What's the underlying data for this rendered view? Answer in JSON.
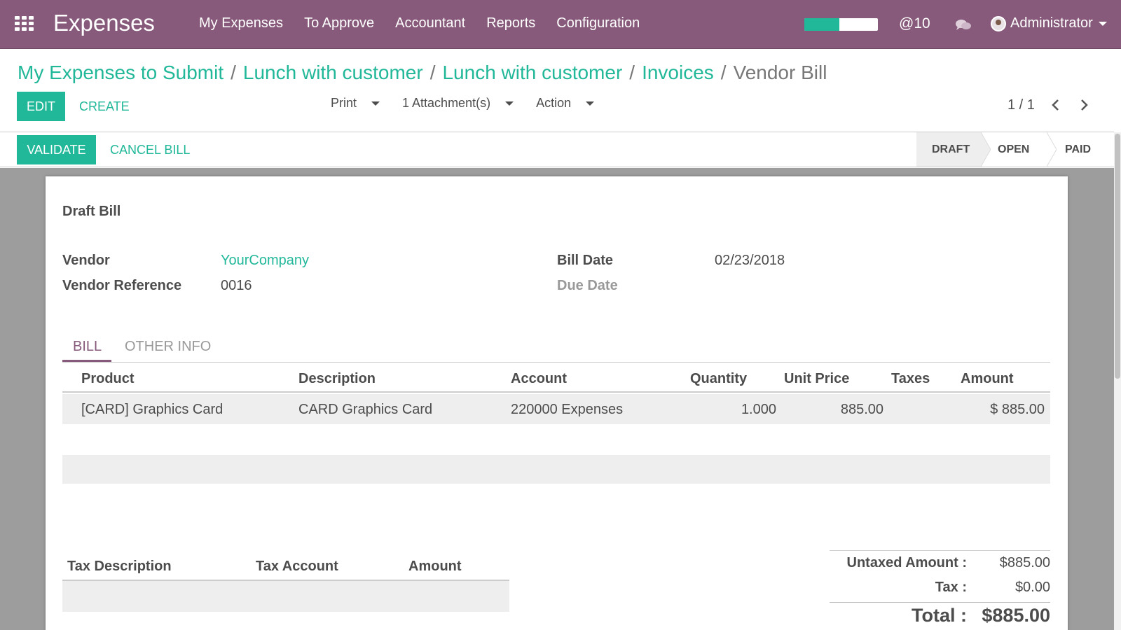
{
  "navbar": {
    "brand": "Expenses",
    "menu": [
      "My Expenses",
      "To Approve",
      "Accountant",
      "Reports",
      "Configuration"
    ],
    "progress_fraction": 0.48,
    "mention_count": "@10",
    "user": "Administrator"
  },
  "breadcrumb": {
    "items": [
      "My Expenses to Submit",
      "Lunch with customer",
      "Lunch with customer",
      "Invoices"
    ],
    "separator": "/",
    "current": "Vendor Bill"
  },
  "buttons": {
    "edit": "EDIT",
    "create": "CREATE",
    "validate": "VALIDATE",
    "cancel_bill": "CANCEL BILL"
  },
  "sidebar_menus": {
    "print": "Print",
    "attachments": "1 Attachment(s)",
    "action": "Action"
  },
  "pager": "1 / 1",
  "stages": [
    "DRAFT",
    "OPEN",
    "PAID"
  ],
  "active_stage": "DRAFT",
  "bill": {
    "title": "Draft Bill",
    "vendor_label": "Vendor",
    "vendor": "YourCompany",
    "vendor_reference_label": "Vendor Reference",
    "vendor_reference": "0016",
    "bill_date_label": "Bill Date",
    "bill_date": "02/23/2018",
    "due_date_label": "Due Date"
  },
  "tabs": [
    "BILL",
    "OTHER INFO"
  ],
  "lines": {
    "columns": [
      "Product",
      "Description",
      "Account",
      "Quantity",
      "Unit Price",
      "Taxes",
      "Amount"
    ],
    "rows": [
      {
        "product": "[CARD] Graphics Card",
        "description": "CARD  Graphics Card",
        "account": "220000 Expenses",
        "quantity": "1.000",
        "unit_price": "885.00",
        "taxes": "",
        "amount": "$ 885.00"
      }
    ]
  },
  "tax_table": {
    "columns": [
      "Tax Description",
      "Tax Account",
      "Amount"
    ]
  },
  "totals": {
    "untaxed_label": "Untaxed Amount :",
    "untaxed": "$885.00",
    "tax_label": "Tax :",
    "tax": "$0.00",
    "total_label": "Total :",
    "total": "$885.00"
  },
  "colors": {
    "navbar": "#875a7b",
    "accent": "#21b799",
    "sheet_background": "#9d9d9d"
  },
  "icons": [
    "apps-grid-icon",
    "chat-bubbles-icon",
    "chevron-left-icon",
    "chevron-right-icon",
    "caret-down-icon"
  ]
}
